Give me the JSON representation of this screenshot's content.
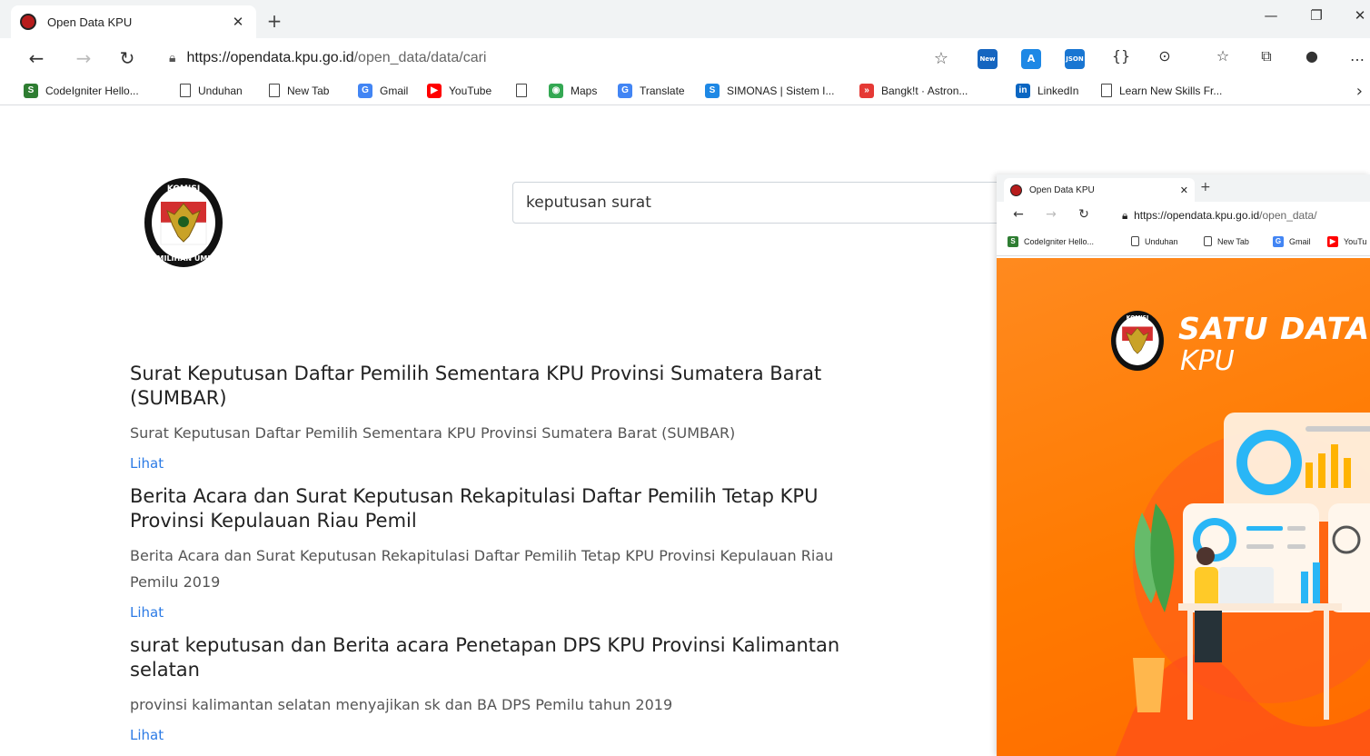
{
  "browser": {
    "tab_title": "Open Data KPU",
    "url_host": "https://opendata.kpu.go.id",
    "url_path": "/open_data/data/cari",
    "extensions": [
      {
        "label": "New",
        "color": "#1565c0"
      },
      {
        "label": "A",
        "color": "#1e88e5"
      },
      {
        "label": "JSON",
        "color": "#1976d2"
      }
    ],
    "bookmarks": [
      {
        "label": "CodeIgniter Hello...",
        "icon": "codeigniter-icon",
        "color": "#2e7d32",
        "glyph": "S"
      },
      {
        "label": "Unduhan",
        "icon": "page-icon"
      },
      {
        "label": "New Tab",
        "icon": "page-icon"
      },
      {
        "label": "Gmail",
        "icon": "google-icon",
        "color": "#4285f4",
        "glyph": "G"
      },
      {
        "label": "YouTube",
        "icon": "youtube-icon",
        "color": "#ff0000",
        "glyph": "▶"
      },
      {
        "label": "",
        "icon": "page-icon"
      },
      {
        "label": "Maps",
        "icon": "maps-icon",
        "color": "#34a853",
        "glyph": "◉"
      },
      {
        "label": "Translate",
        "icon": "translate-icon",
        "color": "#4285f4",
        "glyph": "G"
      },
      {
        "label": "SIMONAS | Sistem I...",
        "icon": "simonas-icon",
        "color": "#1e88e5",
        "glyph": "S"
      },
      {
        "label": "Bangk!t · Astron...",
        "icon": "bangkit-icon",
        "color": "#e53935",
        "glyph": "»"
      },
      {
        "label": "LinkedIn",
        "icon": "linkedin-icon",
        "color": "#0a66c2",
        "glyph": "in"
      },
      {
        "label": "Learn New Skills Fr...",
        "icon": "page-icon"
      }
    ]
  },
  "page": {
    "search_value": "keputusan surat",
    "results": [
      {
        "title": "Surat Keputusan Daftar Pemilih Sementara KPU Provinsi Sumatera Barat (SUMBAR)",
        "description": "Surat Keputusan Daftar Pemilih Sementara KPU Provinsi Sumatera Barat (SUMBAR)",
        "link": "Lihat"
      },
      {
        "title": "Berita Acara dan Surat Keputusan Rekapitulasi Daftar Pemilih Tetap KPU Provinsi Kepulauan Riau Pemil",
        "description": "Berita Acara dan Surat Keputusan Rekapitulasi Daftar Pemilih Tetap KPU Provinsi Kepulauan Riau Pemilu 2019",
        "link": "Lihat"
      },
      {
        "title": "surat keputusan dan Berita acara Penetapan DPS KPU Provinsi Kalimantan selatan",
        "description": "provinsi kalimantan selatan menyajikan sk dan BA DPS Pemilu tahun 2019",
        "link": "Lihat"
      }
    ]
  },
  "overlay": {
    "tab_title": "Open Data KPU",
    "url_host": "https://opendata.kpu.go.id",
    "url_path": "/open_data/",
    "bookmarks": [
      {
        "label": "CodeIgniter Hello...",
        "color": "#2e7d32",
        "glyph": "S"
      },
      {
        "label": "Unduhan"
      },
      {
        "label": "New Tab"
      },
      {
        "label": "Gmail",
        "color": "#4285f4",
        "glyph": "G"
      },
      {
        "label": "YouTu",
        "color": "#ff0000",
        "glyph": "▶"
      }
    ],
    "brand_line1": "SATU DATA",
    "brand_line2": "KPU",
    "hero_color": "#ff7a00"
  }
}
